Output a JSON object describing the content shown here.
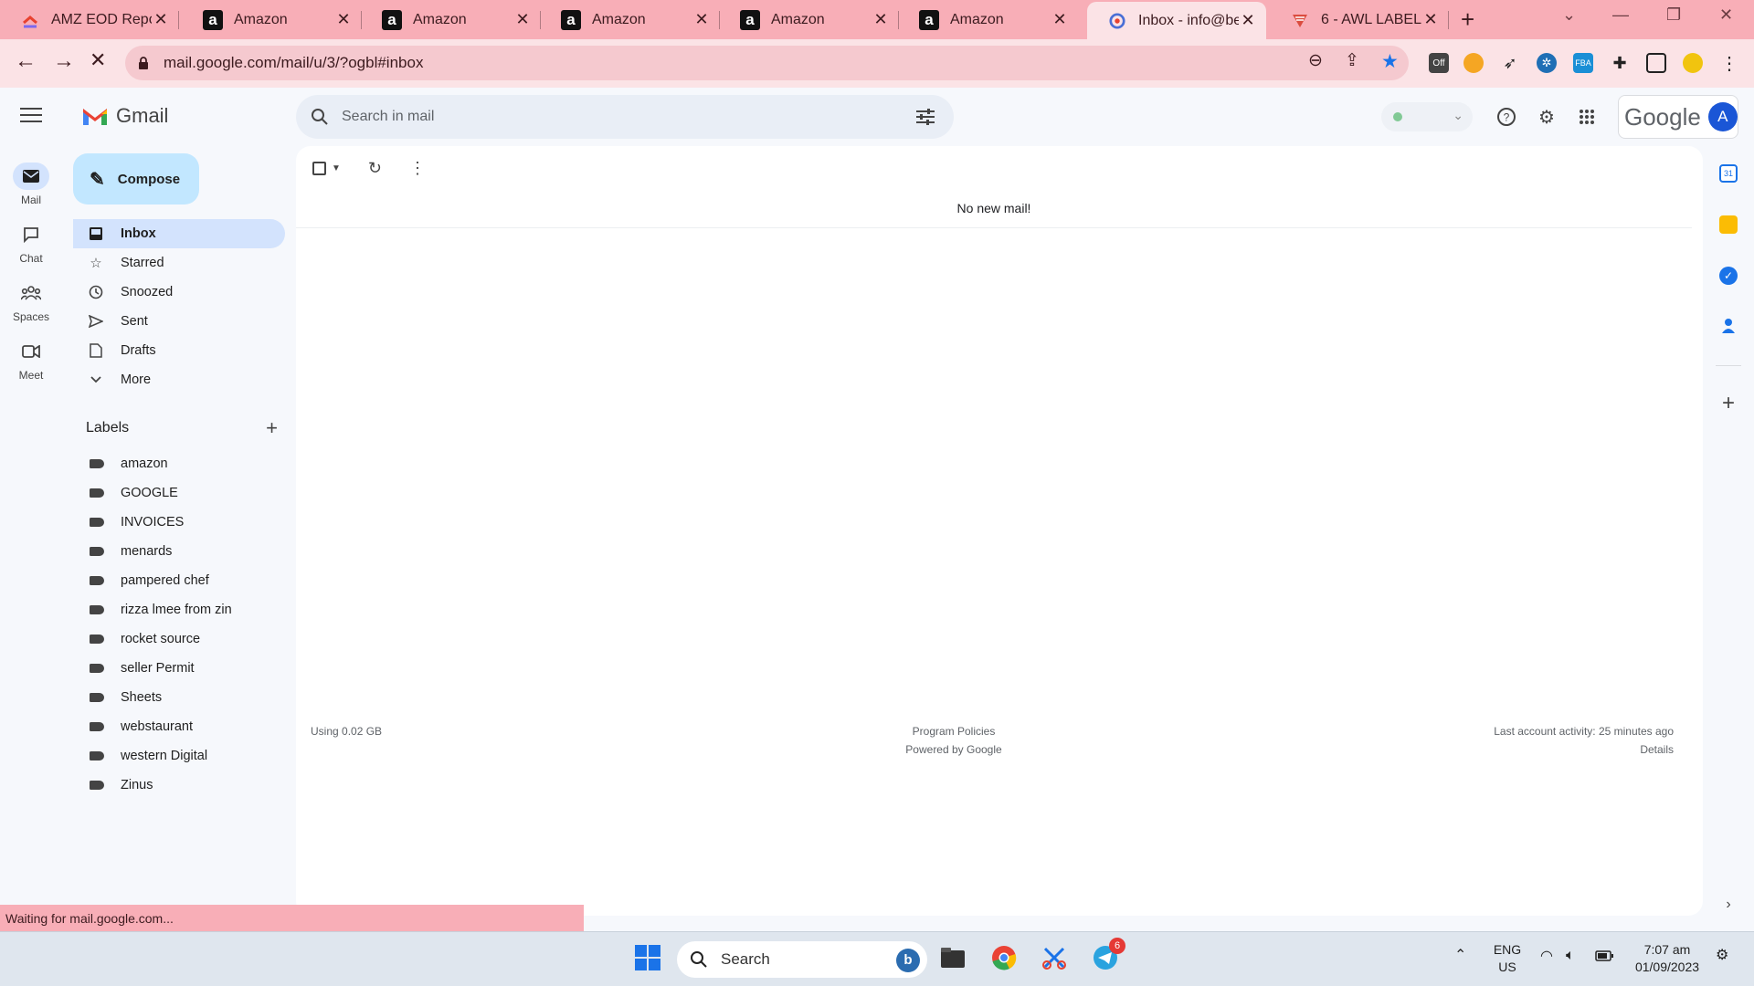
{
  "browser": {
    "tabs": [
      {
        "title": "AMZ EOD Report",
        "icon": "clickup-icon"
      },
      {
        "title": "Amazon",
        "icon": "amazon-icon"
      },
      {
        "title": "Amazon",
        "icon": "amazon-icon"
      },
      {
        "title": "Amazon",
        "icon": "amazon-icon"
      },
      {
        "title": "Amazon",
        "icon": "amazon-icon"
      },
      {
        "title": "Amazon",
        "icon": "amazon-icon"
      },
      {
        "title": "Inbox - info@bes",
        "icon": "gmail-icon",
        "active": true
      },
      {
        "title": "6 - AWL LABEL",
        "icon": "todoist-icon"
      }
    ],
    "url": "mail.google.com/mail/u/3/?ogbl#inbox",
    "status_text": "Waiting for mail.google.com...",
    "extension_badge": "Off",
    "colors": {
      "tabstrip": "#f8aeb7",
      "toolbar": "#fbe3e6",
      "star": "#1a73e8"
    }
  },
  "gmail": {
    "app_name": "Gmail",
    "search_placeholder": "Search in mail",
    "google_wordmark": "Google",
    "avatar_letter": "A",
    "rail": [
      {
        "label": "Mail",
        "icon": "mail-icon",
        "active": true
      },
      {
        "label": "Chat",
        "icon": "chat-icon"
      },
      {
        "label": "Spaces",
        "icon": "spaces-icon"
      },
      {
        "label": "Meet",
        "icon": "meet-icon"
      }
    ],
    "compose_label": "Compose",
    "nav": [
      {
        "label": "Inbox",
        "icon": "inbox-icon",
        "active": true
      },
      {
        "label": "Starred",
        "icon": "star-icon"
      },
      {
        "label": "Snoozed",
        "icon": "clock-icon"
      },
      {
        "label": "Sent",
        "icon": "send-icon"
      },
      {
        "label": "Drafts",
        "icon": "draft-icon"
      },
      {
        "label": "More",
        "icon": "chevron-down-icon"
      }
    ],
    "labels_title": "Labels",
    "labels": [
      "amazon",
      "GOOGLE",
      "INVOICES",
      "menards",
      "pampered chef",
      "rizza lmee from zin",
      "rocket source",
      "seller Permit",
      "Sheets",
      "webstaurant",
      "western Digital",
      "Zinus"
    ],
    "empty_message": "No new mail!",
    "footer": {
      "storage": "Using 0.02 GB",
      "policies": "Program Policies",
      "powered": "Powered by Google",
      "activity": "Last account activity: 25 minutes ago",
      "details": "Details"
    }
  },
  "taskbar": {
    "search_label": "Search",
    "language": "ENG",
    "region": "US",
    "time": "7:07 am",
    "date": "01/09/2023",
    "telegram_badge": "6"
  }
}
